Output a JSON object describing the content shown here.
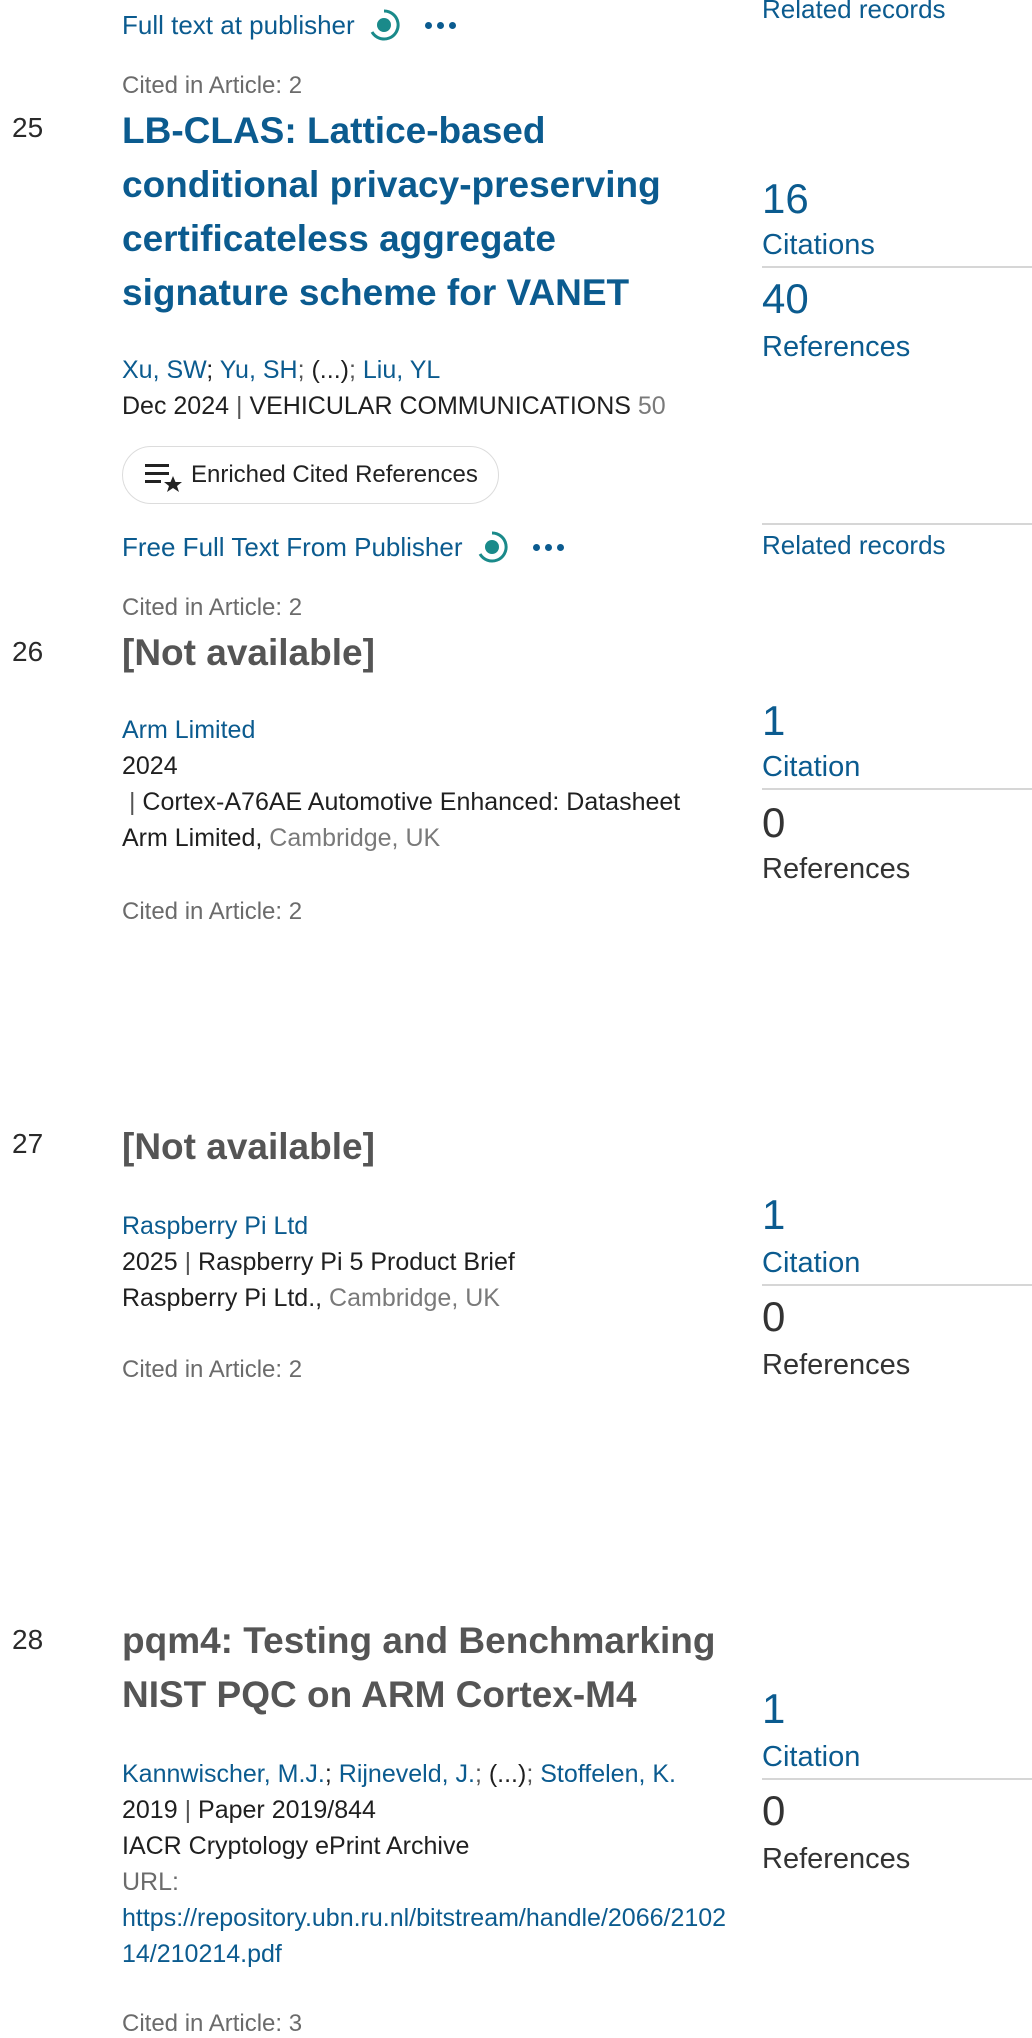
{
  "top": {
    "full_text_link": "Full text at publisher",
    "related_records": "Related records",
    "cited_in": "Cited in Article: 2"
  },
  "records": [
    {
      "index": "25",
      "title": "LB-CLAS: Lattice-based conditional privacy-preserving certificateless aggregate signature scheme for VANET",
      "authors": [
        "Xu, SW",
        "Yu, SH",
        "(...)",
        "Liu, YL"
      ],
      "date": "Dec 2024",
      "journal": "VEHICULAR COMMUNICATIONS",
      "volume": "50",
      "enriched_label": "Enriched Cited References",
      "free_full_text": "Free Full Text From Publisher",
      "related_records": "Related records",
      "citations_count": "16",
      "citations_label": "Citations",
      "references_count": "40",
      "references_label": "References",
      "cited_in": "Cited in Article: 2"
    },
    {
      "index": "26",
      "title": "[Not available]",
      "author": "Arm Limited",
      "year": "2024",
      "line2": "Cortex-A76AE Automotive Enhanced: Datasheet",
      "publisher": "Arm Limited",
      "location": "Cambridge, UK",
      "citations_count": "1",
      "citations_label": "Citation",
      "references_count": "0",
      "references_label": "References",
      "cited_in": "Cited in Article: 2"
    },
    {
      "index": "27",
      "title": "[Not available]",
      "author": "Raspberry Pi Ltd",
      "year": "2025",
      "line2": "Raspberry Pi 5 Product Brief",
      "publisher": "Raspberry Pi Ltd.",
      "location": "Cambridge, UK",
      "citations_count": "1",
      "citations_label": "Citation",
      "references_count": "0",
      "references_label": "References",
      "cited_in": "Cited in Article: 2"
    },
    {
      "index": "28",
      "title": "pqm4: Testing and Benchmarking NIST PQC on ARM Cortex-M4",
      "authors": [
        "Kannwischer, M.J.",
        "Rijneveld, J.",
        "(...)",
        "Stoffelen, K."
      ],
      "year": "2019",
      "paper": "Paper 2019/844",
      "venue": "IACR Cryptology ePrint Archive",
      "url_label": "URL:",
      "url": "https://repository.ubn.ru.nl/bitstream/handle/2066/210214/210214.pdf",
      "citations_count": "1",
      "citations_label": "Citation",
      "references_count": "0",
      "references_label": "References",
      "cited_in": "Cited in Article: 3"
    }
  ],
  "icons": {
    "open_access": "open-access-icon",
    "more": "more-options-icon",
    "enriched": "enriched-references-icon"
  },
  "colors": {
    "link": "#0b5b8f",
    "open_access": "#1a8a8a",
    "muted": "#6b6b6b"
  }
}
